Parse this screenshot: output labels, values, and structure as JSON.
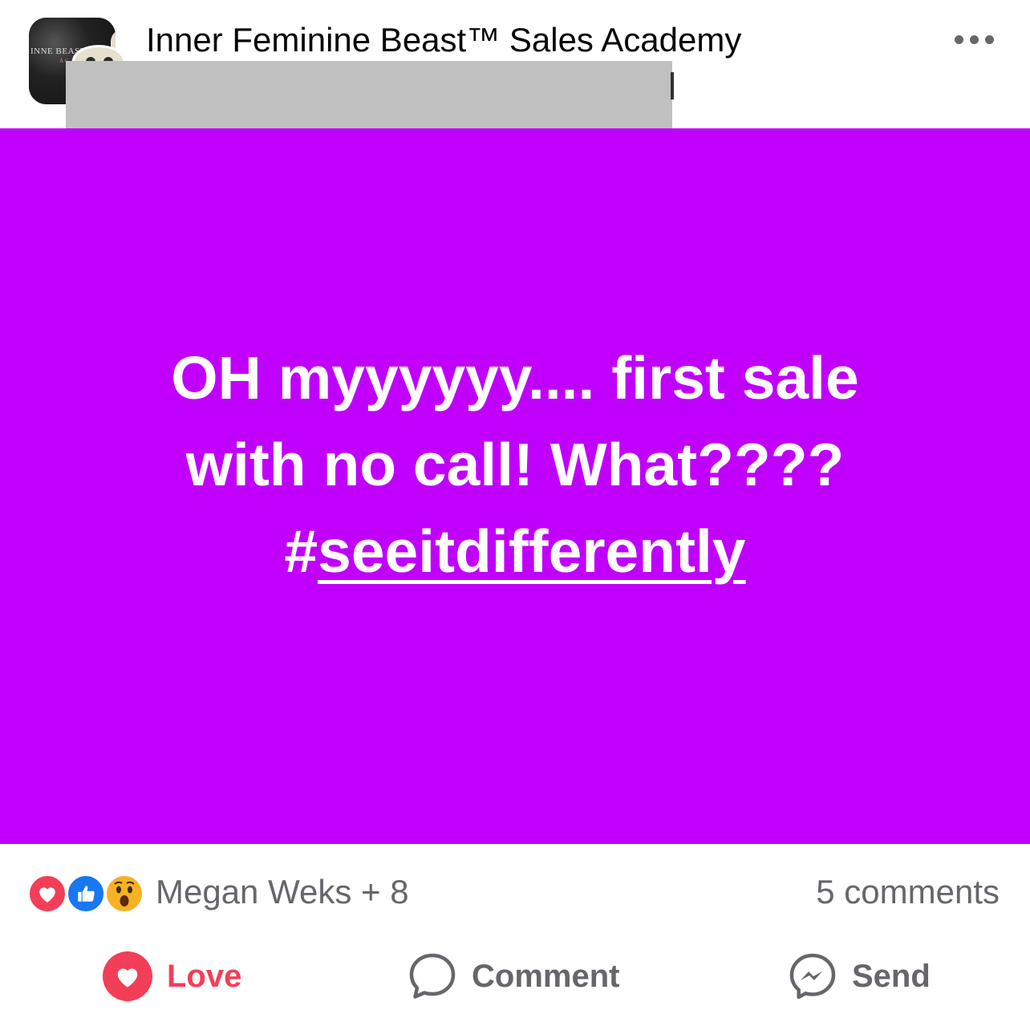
{
  "header": {
    "group_name": "Inner Feminine Beast™ Sales Academy",
    "avatar_text": "INNE BEAST",
    "avatar_subtext": "ACADEMY",
    "more_icon": "more-horizontal-icon"
  },
  "post": {
    "background_color": "#c000fc",
    "line1": "OH myyyyyy.... first sale",
    "line2": "with no call! What????",
    "hashtag_symbol": "#",
    "hashtag_text": "seeitdifferently"
  },
  "reactions": {
    "icons": [
      "love-reaction-icon",
      "like-reaction-icon",
      "wow-reaction-icon"
    ],
    "summary": "Megan Weks + 8",
    "comments_count": "5 comments"
  },
  "actions": {
    "love_label": "Love",
    "comment_label": "Comment",
    "send_label": "Send"
  },
  "colors": {
    "love": "#f33e58",
    "like": "#1877f2",
    "wow": "#f7b125",
    "muted_text": "#65676b"
  }
}
